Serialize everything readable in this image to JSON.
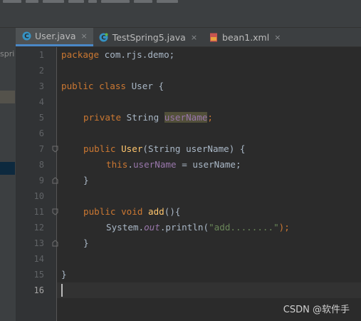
{
  "tabs": [
    {
      "label": "User.java",
      "close": "×",
      "icon": "java-class-icon"
    },
    {
      "label": "TestSpring5.java",
      "close": "×",
      "icon": "java-class-icon"
    },
    {
      "label": "bean1.xml",
      "close": "×",
      "icon": "xml-file-icon"
    }
  ],
  "project_panel": {
    "label": "spri"
  },
  "line_numbers": [
    "1",
    "2",
    "3",
    "4",
    "5",
    "6",
    "7",
    "8",
    "9",
    "10",
    "11",
    "12",
    "13",
    "14",
    "15",
    "16"
  ],
  "code": {
    "l1_kw": "package",
    "l1_rest": " com.rjs.demo;",
    "l3_kw": "public class",
    "l3_rest": " User {",
    "l5_kw": "private",
    "l5_type": " String ",
    "l5_field": "userName",
    "l5_semi": ";",
    "l7_kw": "public",
    "l7_fn": " User",
    "l7_rest": "(String userName) {",
    "l8_kw": "this",
    "l8_dot": ".",
    "l8_field": "userName",
    "l8_rest": " = userName;",
    "l9": "}",
    "l11_kw": "public void",
    "l11_fn": " add",
    "l11_rest": "(){",
    "l12_a": "System.",
    "l12_out": "out",
    "l12_b": ".println(",
    "l12_str": "\"add........\"",
    "l12_c": ");",
    "l13": "}",
    "l15": "}"
  },
  "watermark": "CSDN @软件手",
  "colors": {
    "keyword": "#cc7832",
    "function": "#ffc66d",
    "field": "#9876aa",
    "string": "#6a8759",
    "text": "#a9b7c6",
    "tab_active_underline": "#4a88c7"
  }
}
